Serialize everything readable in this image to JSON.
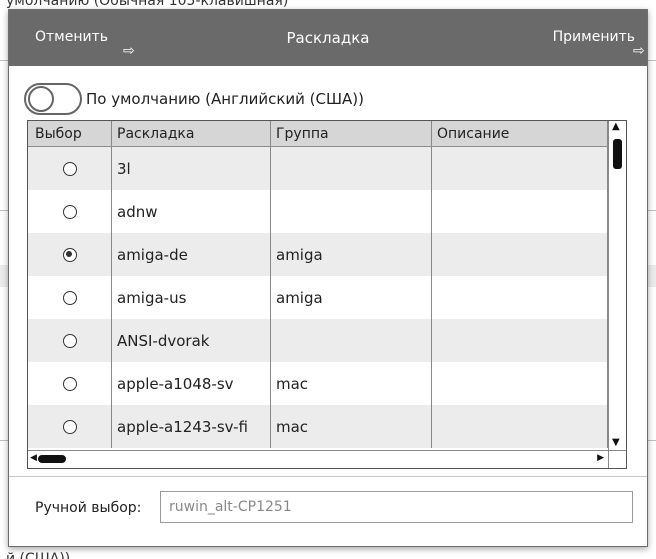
{
  "background": {
    "top_text": "умолчанию (Обычная 105-клавишная)",
    "bottom_text": "й (США))"
  },
  "header": {
    "title": "Раскладка",
    "cancel_label": "Отменить",
    "apply_label": "Применить",
    "arrow_icon": "⇨"
  },
  "toggle": {
    "label": "По умолчанию (Английский (США))",
    "state": "off"
  },
  "table": {
    "columns": [
      "Выбор",
      "Раскладка",
      "Группа",
      "Описание"
    ],
    "rows": [
      {
        "layout": "3l",
        "group": "",
        "description": "",
        "selected": false
      },
      {
        "layout": "adnw",
        "group": "",
        "description": "",
        "selected": false
      },
      {
        "layout": "amiga-de",
        "group": "amiga",
        "description": "",
        "selected": true
      },
      {
        "layout": "amiga-us",
        "group": "amiga",
        "description": "",
        "selected": false
      },
      {
        "layout": "ANSI-dvorak",
        "group": "",
        "description": "",
        "selected": false
      },
      {
        "layout": "apple-a1048-sv",
        "group": "mac",
        "description": "",
        "selected": false
      },
      {
        "layout": "apple-a1243-sv-fi",
        "group": "mac",
        "description": "",
        "selected": false
      }
    ]
  },
  "manual": {
    "label": "Ручной выбор:",
    "value": "ruwin_alt-CP1251"
  }
}
